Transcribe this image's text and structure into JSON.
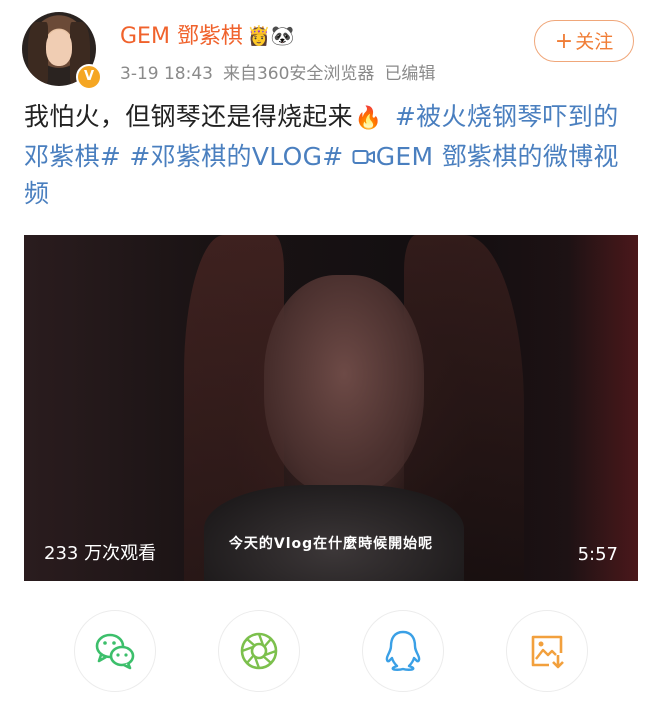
{
  "post": {
    "author": "GEM 鄧紫棋",
    "author_emojis": "👸🐼",
    "verified_badge": "V",
    "date": "3-19 18:43",
    "source": "来自360安全浏览器",
    "edited": "已编辑",
    "follow_label": "关注",
    "text_plain": "我怕火，但钢琴还是得烧起来",
    "fire_emoji": "🔥",
    "tag1": "#被火烧钢琴吓到的邓紫棋#",
    "tag2": "#邓紫棋的VLOG#",
    "video_link": "GEM 鄧紫棋的微博视频"
  },
  "video": {
    "views": "233 万次观看",
    "subtitle": "今天的Vlog在什麼時候開始呢",
    "duration": "5:57"
  },
  "share_buttons": [
    {
      "name": "wechat",
      "icon": "wechat-icon",
      "color": "#3cbf6b"
    },
    {
      "name": "moments",
      "icon": "moments-icon",
      "color": "#7cc04d"
    },
    {
      "name": "qq",
      "icon": "qq-icon",
      "color": "#3aa0e6"
    },
    {
      "name": "save-image",
      "icon": "save-image-icon",
      "color": "#f2a03d"
    }
  ]
}
